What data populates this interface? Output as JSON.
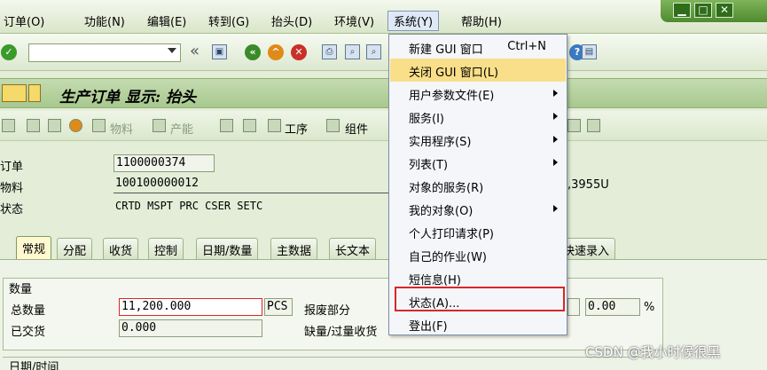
{
  "menubar": {
    "items": [
      "订单(O)",
      "功能(N)",
      "编辑(E)",
      "转到(G)",
      "抬头(D)",
      "环境(V)",
      "系统(Y)",
      "帮助(H)"
    ]
  },
  "window_controls": {
    "minimize": "▁",
    "restore": "□",
    "close": "✕"
  },
  "toolbar": {
    "back_glyph": "«"
  },
  "page": {
    "title": "生产订单 显示: 抬头"
  },
  "app_toolbar": {
    "material_label": "物料",
    "capacity_label": "产能",
    "operations_label": "工序",
    "components_label": "组件"
  },
  "header": {
    "order_label": "订单",
    "order_value": "1100000374",
    "material_label": "物料",
    "material_value": "100100000012",
    "material_desc": ",3955U",
    "status_label": "状态",
    "status_value": "CRTD MSPT PRC  CSER SETC"
  },
  "tabs": [
    "常规",
    "分配",
    "收货",
    "控制",
    "日期/数量",
    "主数据",
    "长文本",
    "快速录入"
  ],
  "quantity_group": {
    "title": "数量",
    "total_qty_label": "总数量",
    "total_qty_value": "11,200.000",
    "unit": "PCS",
    "scrap_label": "报废部分",
    "scrap_value": "0.00",
    "scrap_unit": "%",
    "delivered_label": "已交货",
    "delivered_value": "0.000",
    "shortage_label": "缺量/过量收货"
  },
  "dates_group": {
    "title": "日期/时间"
  },
  "system_menu": {
    "items": [
      {
        "label": "新建 GUI 窗口",
        "shortcut": "Ctrl+N"
      },
      {
        "label": "关闭 GUI 窗口(L)"
      },
      {
        "label": "用户参数文件(E)",
        "submenu": true
      },
      {
        "label": "服务(I)",
        "submenu": true
      },
      {
        "label": "实用程序(S)",
        "submenu": true
      },
      {
        "label": "列表(T)",
        "submenu": true
      },
      {
        "label": "对象的服务(R)"
      },
      {
        "label": "我的对象(O)",
        "submenu": true
      },
      {
        "label": "个人打印请求(P)"
      },
      {
        "label": "自己的作业(W)"
      },
      {
        "label": "短信息(H)"
      },
      {
        "label": "状态(A)..."
      },
      {
        "label": "登出(F)"
      }
    ]
  },
  "watermark": "CSDN @我小时候很黑",
  "colors": {
    "accent": "#d8262a",
    "highlight": "#fadf8a",
    "theme": "#a8c88e"
  }
}
